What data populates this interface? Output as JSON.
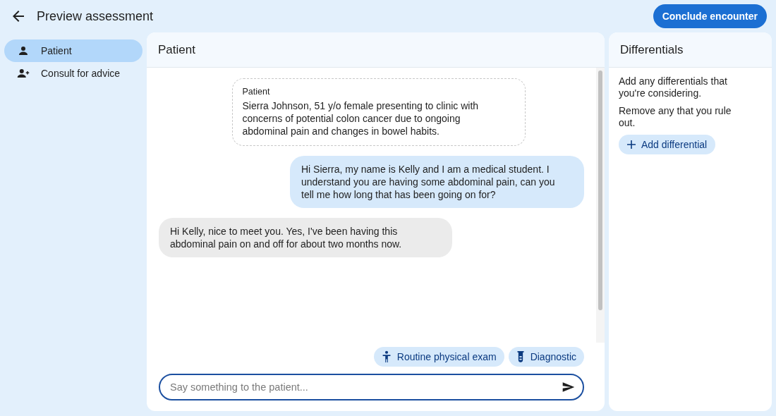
{
  "header": {
    "title": "Preview assessment",
    "action": "Conclude encounter"
  },
  "sidebar": {
    "items": [
      {
        "label": "Patient",
        "kind": "person",
        "selected": true
      },
      {
        "label": "Consult for advice",
        "kind": "add-person",
        "selected": false
      }
    ]
  },
  "chat": {
    "title": "Patient",
    "messages": [
      {
        "kind": "context",
        "sender": "Patient",
        "text": "Sierra Johnson, 51 y/o female presenting to clinic with concerns of potential colon cancer due to ongoing abdominal pain and changes in bowel habits."
      },
      {
        "kind": "sent",
        "text": "Hi Sierra, my name is Kelly and I am a medical student. I understand you are having some abdominal pain, can you tell me how long that has been going on for?"
      },
      {
        "kind": "received",
        "text": "Hi Kelly, nice to meet you. Yes, I've been having this abdominal pain on and off for about two months now."
      }
    ],
    "actions": [
      {
        "label": "Routine physical exam",
        "kind": "exam"
      },
      {
        "label": "Diagnostic",
        "kind": "test"
      }
    ],
    "input": {
      "placeholder": "Say something to the patient..."
    }
  },
  "differentials": {
    "title": "Differentials",
    "hints": [
      "Add any differentials that you're considering.",
      "Remove any that you rule out."
    ],
    "button": "Add differential"
  }
}
